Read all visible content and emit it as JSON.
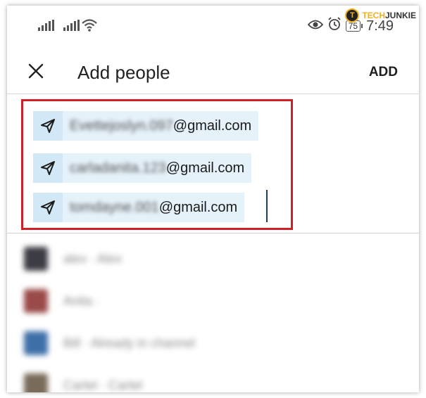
{
  "watermark": {
    "logo_letter": "T",
    "tech": "TECH",
    "junkie": "JUNKIE"
  },
  "status": {
    "time": "7:49",
    "battery": "75"
  },
  "header": {
    "title": "Add people",
    "add_label": "ADD"
  },
  "chips": [
    {
      "name_part": "Evettejoslyn.097",
      "domain": "@gmail.com"
    },
    {
      "name_part": "carladanita.123",
      "domain": "@gmail.com"
    },
    {
      "name_part": "tomdayne.001",
      "domain": "@gmail.com"
    }
  ],
  "list": [
    {
      "text": "alex · Alex",
      "avatar_color": "#3c3c44"
    },
    {
      "text": "Anita ·",
      "avatar_color": "#9b4a4a"
    },
    {
      "text": "Bill · Already in channel",
      "avatar_color": "#3f6fa8"
    },
    {
      "text": "Cartel · Cartel",
      "avatar_color": "#7a6a5a"
    }
  ],
  "colors": {
    "highlight_border": "#d21f26",
    "chip_bg": "#e6f2fa",
    "chip_icon_bg": "#d2e8f6"
  }
}
